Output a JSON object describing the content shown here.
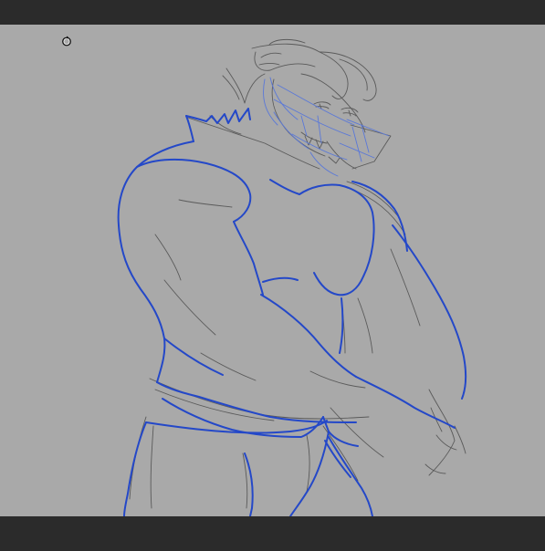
{
  "app": {
    "canvas_background": "#a9a9a9",
    "chrome_color": "#2b2b2b"
  },
  "canvas": {
    "cursor_icon": "rotate-cursor-icon",
    "artwork": "drawing-sketch"
  },
  "colors": {
    "ink_blue": "#2448c8",
    "sketch_gray": "#5a5a5a",
    "sketch_light_blue": "#5a78d8"
  }
}
